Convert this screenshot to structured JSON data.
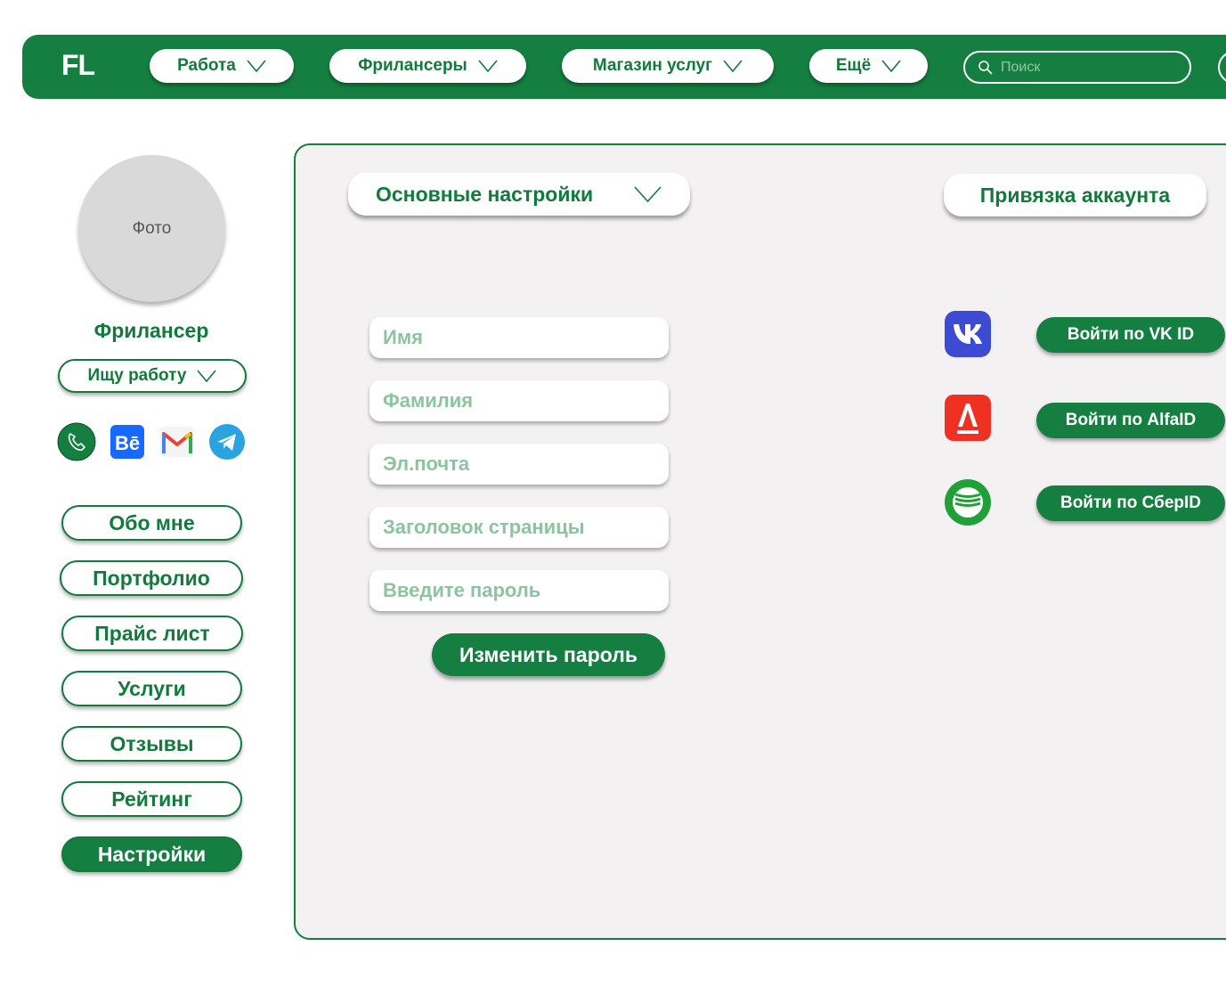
{
  "header": {
    "logo": "FL",
    "nav": [
      {
        "label": "Работа"
      },
      {
        "label": "Фрилансеры"
      },
      {
        "label": "Магазин услуг"
      },
      {
        "label": "Ещё"
      }
    ],
    "search_placeholder": "Поиск"
  },
  "profile": {
    "photo_label": "Фото",
    "role": "Фрилансер",
    "status": "Ищу работу",
    "contacts": [
      "phone-icon",
      "behance-icon",
      "gmail-icon",
      "telegram-icon"
    ]
  },
  "sidebar": {
    "items": [
      {
        "label": "Обо мне"
      },
      {
        "label": "Портфолио"
      },
      {
        "label": "Прайс лист"
      },
      {
        "label": "Услуги"
      },
      {
        "label": "Отзывы"
      },
      {
        "label": "Рейтинг"
      },
      {
        "label": "Настройки",
        "active": true
      }
    ]
  },
  "settings": {
    "main_section": "Основные настройки",
    "fields": [
      {
        "placeholder": "Имя"
      },
      {
        "placeholder": "Фамилия"
      },
      {
        "placeholder": "Эл.почта"
      },
      {
        "placeholder": "Заголовок страницы"
      },
      {
        "placeholder": "Введите пароль"
      }
    ],
    "change_password": "Изменить пароль",
    "account_link_section": "Привязка аккаунта",
    "logins": [
      {
        "label": "Войти по VK ID",
        "icon": "vk-icon"
      },
      {
        "label": "Войти по AlfaID",
        "icon": "alfa-icon"
      },
      {
        "label": "Войти по СберID",
        "icon": "sber-icon"
      }
    ]
  },
  "colors": {
    "brand": "#147f40",
    "panel_bg": "#f3f1f2",
    "placeholder": "#8cc4a0"
  }
}
